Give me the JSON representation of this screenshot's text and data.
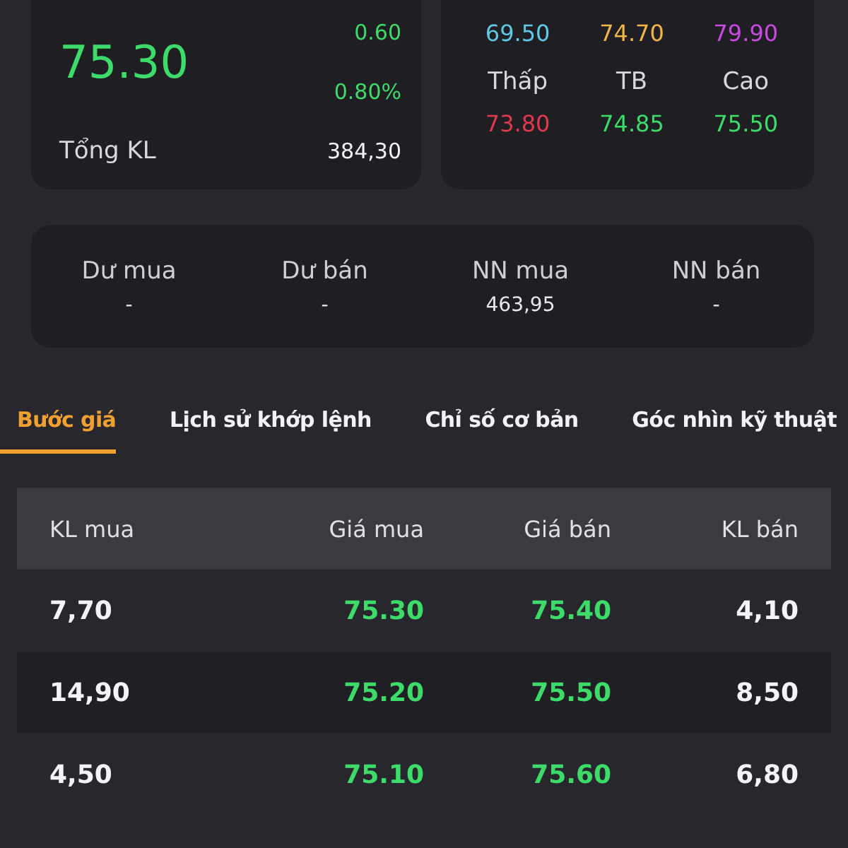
{
  "price_card": {
    "price": "75.30",
    "change": "0.60",
    "change_pct": "0.80%",
    "total_label": "Tổng KL",
    "total_value": "384,30"
  },
  "range_card": {
    "top_values": [
      {
        "value": "69.50",
        "color": "#5ec8e6"
      },
      {
        "value": "74.70",
        "color": "#f0b44a"
      },
      {
        "value": "79.90",
        "color": "#c84ae0"
      }
    ],
    "stats": [
      {
        "label": "Thấp",
        "value": "73.80",
        "color": "#e0384e"
      },
      {
        "label": "TB",
        "value": "74.85",
        "color": "#3ddc6a"
      },
      {
        "label": "Cao",
        "value": "75.50",
        "color": "#3ddc6a"
      }
    ]
  },
  "summary": [
    {
      "label": "Dư mua",
      "value": "-"
    },
    {
      "label": "Dư bán",
      "value": "-"
    },
    {
      "label": "NN mua",
      "value": "463,95"
    },
    {
      "label": "NN bán",
      "value": "-"
    }
  ],
  "tabs": [
    {
      "label": "Bước giá",
      "selected": true
    },
    {
      "label": "Lịch sử khớp lệnh",
      "selected": false
    },
    {
      "label": "Chỉ số cơ bản",
      "selected": false
    },
    {
      "label": "Góc nhìn kỹ thuật",
      "selected": false
    }
  ],
  "table": {
    "columns": [
      {
        "label": "KL mua",
        "kind": "volume"
      },
      {
        "label": "Giá mua",
        "kind": "price"
      },
      {
        "label": "Giá bán",
        "kind": "price"
      },
      {
        "label": "KL bán",
        "kind": "volume"
      }
    ],
    "rows": [
      [
        "7,70",
        "75.30",
        "75.40",
        "4,10"
      ],
      [
        "14,90",
        "75.20",
        "75.50",
        "8,50"
      ],
      [
        "4,50",
        "75.10",
        "75.60",
        "6,80"
      ]
    ]
  }
}
